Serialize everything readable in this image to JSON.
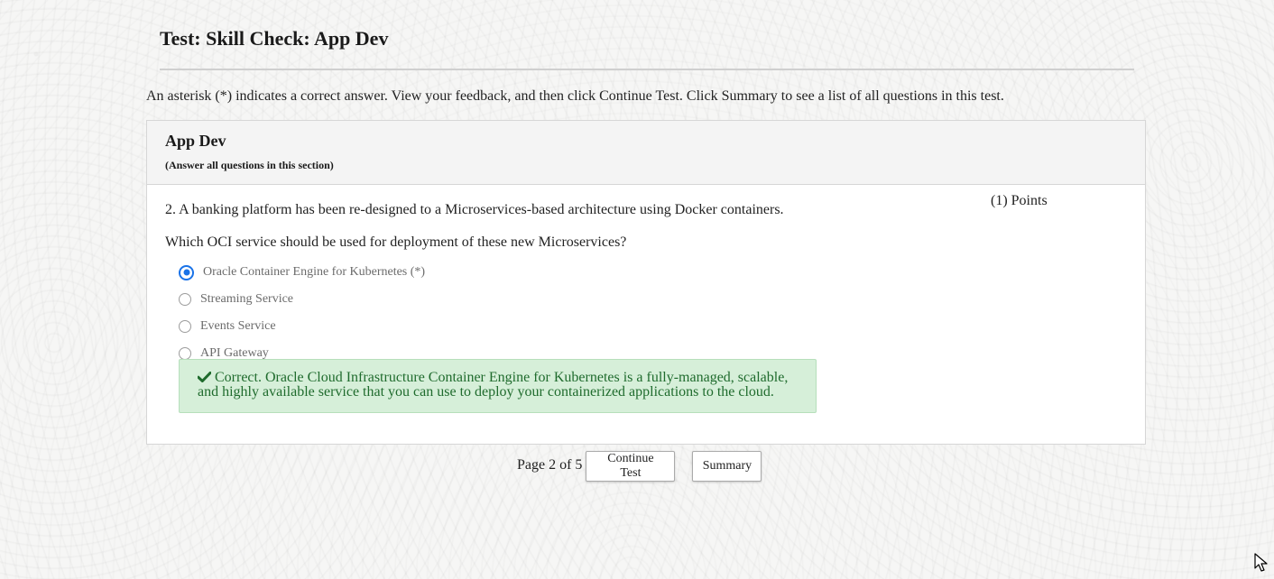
{
  "page": {
    "title": "Test: Skill Check: App Dev",
    "instructions": "An asterisk (*) indicates a correct answer. View your feedback, and then click Continue Test. Click Summary to see a list of all questions in this test."
  },
  "section": {
    "title": "App Dev",
    "note": "(Answer all questions in this section)"
  },
  "question": {
    "text": "2. A banking platform has been re-designed to a Microservices-based architecture using Docker containers.",
    "prompt": "Which OCI service should be used for deployment of these new Microservices?",
    "points": "(1) Points",
    "options": [
      {
        "label": "Oracle Container Engine for Kubernetes (*)",
        "selected": true
      },
      {
        "label": "Streaming Service",
        "selected": false
      },
      {
        "label": "Events Service",
        "selected": false
      },
      {
        "label": "API Gateway",
        "selected": false
      }
    ],
    "feedback_line1": "Correct. Oracle Cloud Infrastructure Container Engine for Kubernetes is a fully-managed, scalable,",
    "feedback_line2": "and highly available service that you can use to deploy your containerized applications to the cloud.",
    "feedback_icon": "checkmark-icon"
  },
  "pager": {
    "indicator": "Page 2 of 5",
    "continue_label": "Continue Test",
    "summary_label": "Summary"
  },
  "colors": {
    "accent": "#1a73e8",
    "feedback_bg": "#d6efd9",
    "feedback_text": "#1f6b2d"
  }
}
